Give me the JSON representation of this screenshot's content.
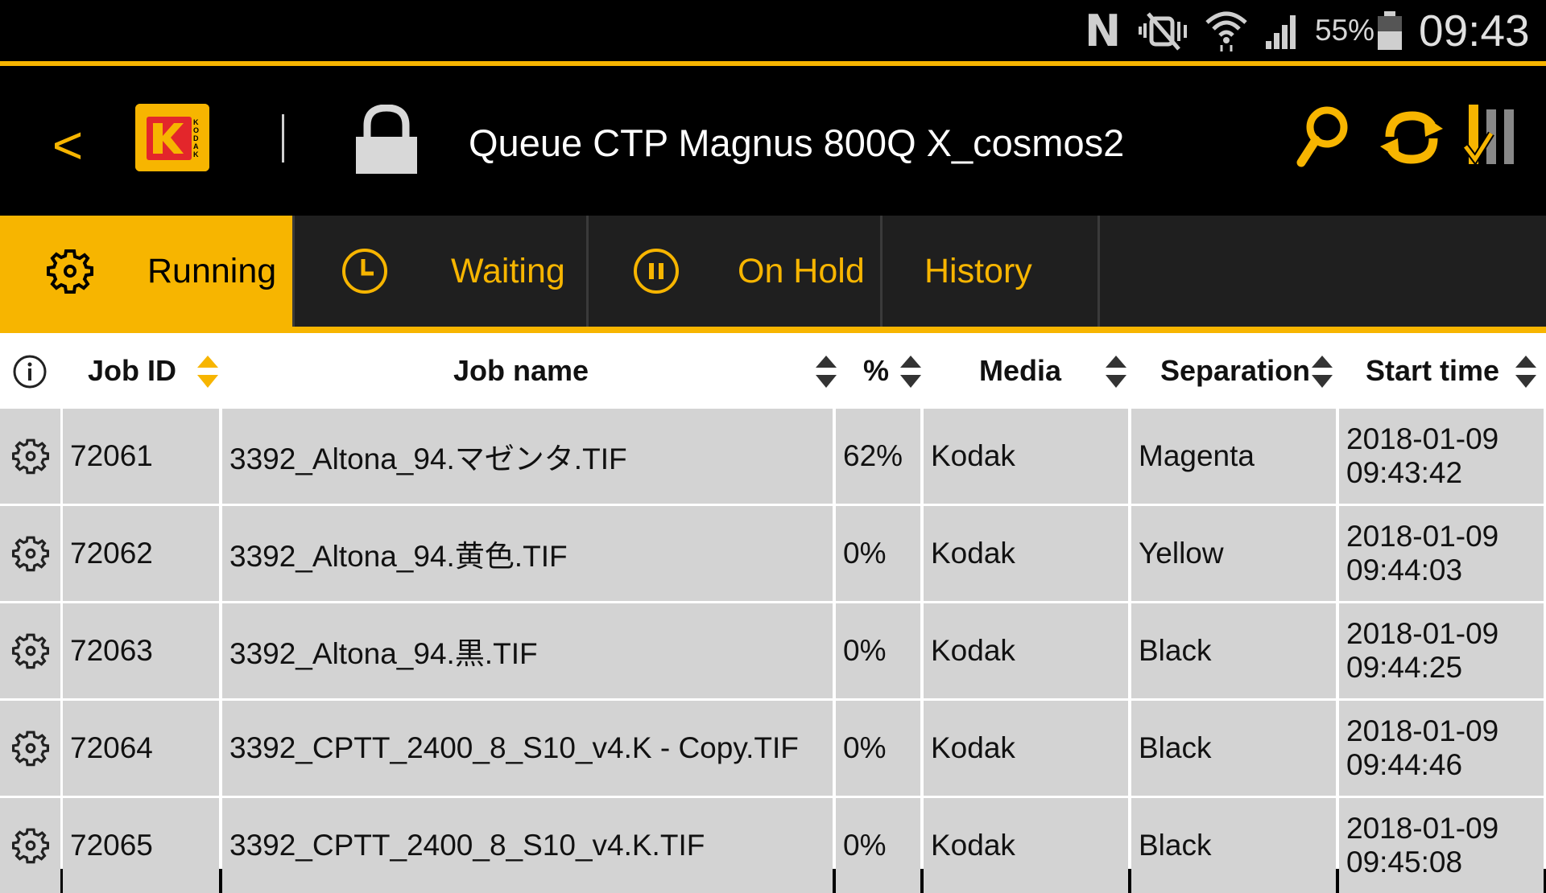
{
  "status_bar": {
    "nfc_label": "N",
    "battery": "55%",
    "time": "09:43",
    "icons": [
      "nfc-icon",
      "mute-icon",
      "wifi-icon",
      "signal-icon",
      "battery-icon"
    ]
  },
  "header": {
    "back_label": "<",
    "logo": "kodak-logo",
    "logo_text": "KODAK",
    "title": "Queue CTP Magnus 800Q X_cosmos2",
    "actions": [
      "search-icon",
      "refresh-icon",
      "queue-control-icon"
    ]
  },
  "colors": {
    "accent": "#f7b500",
    "header_bg": "#000000",
    "tab_bg": "#1f1f1f",
    "row_bg": "#d3d3d3"
  },
  "tabs": [
    {
      "label": "Running",
      "icon": "gear-icon",
      "active": true
    },
    {
      "label": "Waiting",
      "icon": "clock-icon",
      "active": false
    },
    {
      "label": "On Hold",
      "icon": "pause-icon",
      "active": false
    },
    {
      "label": "History",
      "icon": "",
      "active": false
    }
  ],
  "table": {
    "columns": [
      "Job ID",
      "Job name",
      "%",
      "Media",
      "Separation",
      "Start time"
    ],
    "sorted_column": "Job ID",
    "rows": [
      {
        "job_id": "72061",
        "job_name": "3392_Altona_94.マゼンタ.TIF",
        "percent": "62%",
        "media": "Kodak",
        "separation": "Magenta",
        "start_date": "2018-01-09",
        "start_time": "09:43:42"
      },
      {
        "job_id": "72062",
        "job_name": "3392_Altona_94.黄色.TIF",
        "percent": "0%",
        "media": "Kodak",
        "separation": "Yellow",
        "start_date": "2018-01-09",
        "start_time": "09:44:03"
      },
      {
        "job_id": "72063",
        "job_name": "3392_Altona_94.黒.TIF",
        "percent": "0%",
        "media": "Kodak",
        "separation": "Black",
        "start_date": "2018-01-09",
        "start_time": "09:44:25"
      },
      {
        "job_id": "72064",
        "job_name": "3392_CPTT_2400_8_S10_v4.K - Copy.TIF",
        "percent": "0%",
        "media": "Kodak",
        "separation": "Black",
        "start_date": "2018-01-09",
        "start_time": "09:44:46"
      },
      {
        "job_id": "72065",
        "job_name": "3392_CPTT_2400_8_S10_v4.K.TIF",
        "percent": "0%",
        "media": "Kodak",
        "separation": "Black",
        "start_date": "2018-01-09",
        "start_time": "09:45:08"
      }
    ]
  }
}
